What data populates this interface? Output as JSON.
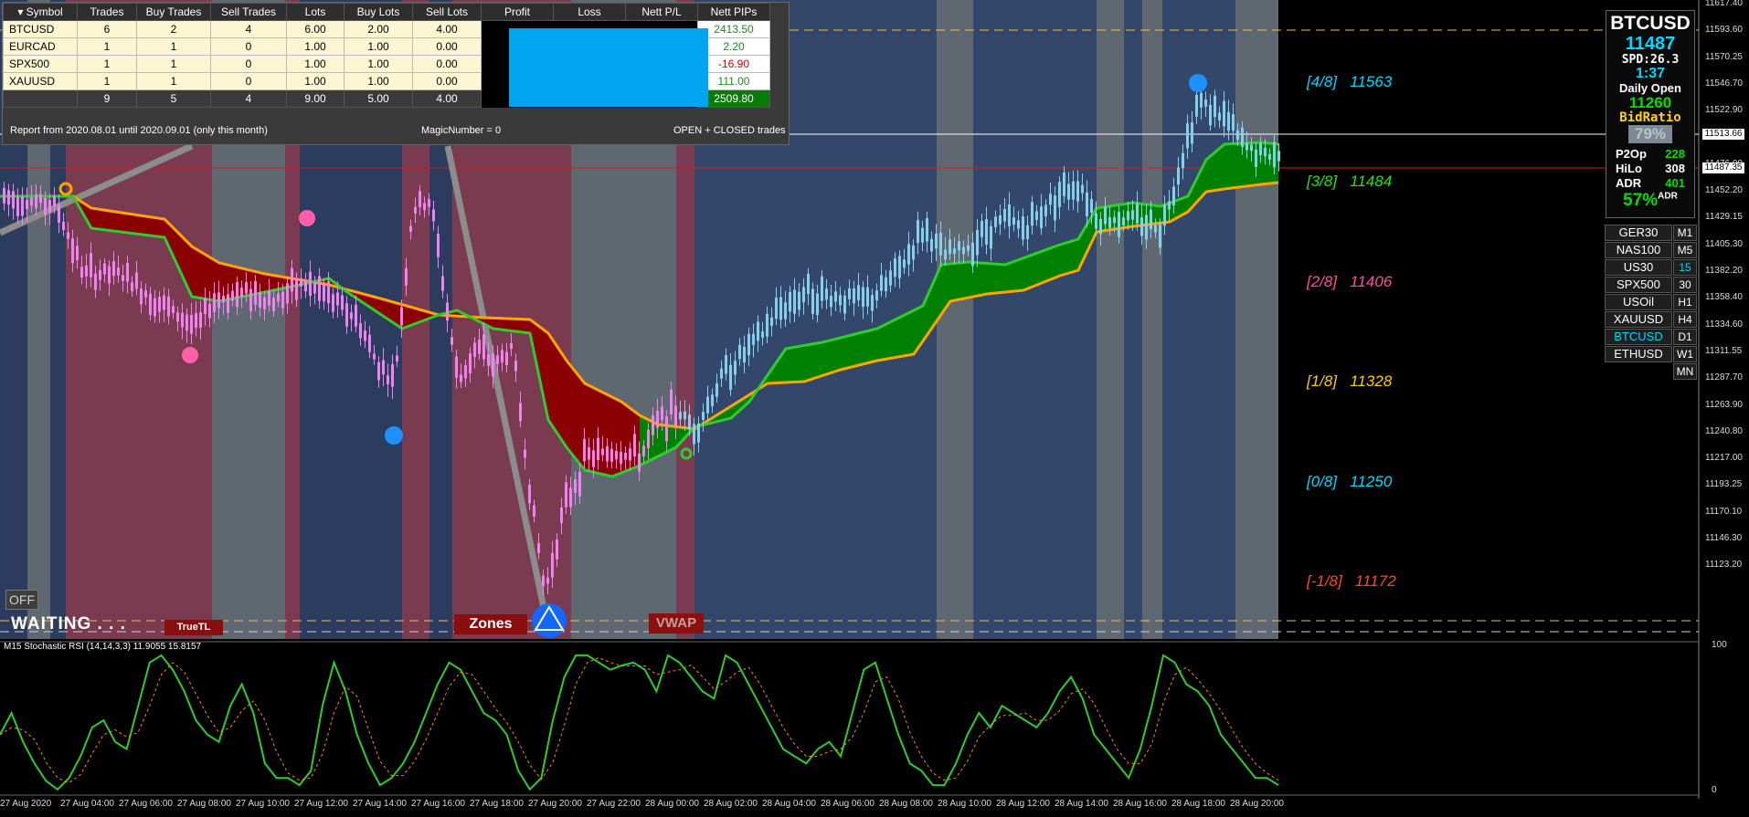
{
  "table": {
    "headers": [
      "Symbol",
      "Trades",
      "Buy Trades",
      "Sell Trades",
      "Lots",
      "Buy Lots",
      "Sell Lots",
      "Profit",
      "Loss",
      "Nett P/L",
      "Nett PIPs"
    ],
    "rows": [
      {
        "symbol": "BTCUSD",
        "trades": "6",
        "buy": "2",
        "sell": "4",
        "lots": "6.00",
        "buylots": "2.00",
        "selllots": "4.00",
        "pips": "2413.50"
      },
      {
        "symbol": "EURCAD",
        "trades": "1",
        "buy": "1",
        "sell": "0",
        "lots": "1.00",
        "buylots": "1.00",
        "selllots": "0.00",
        "pips": "2.20"
      },
      {
        "symbol": "SPX500",
        "trades": "1",
        "buy": "1",
        "sell": "0",
        "lots": "1.00",
        "buylots": "1.00",
        "selllots": "0.00",
        "pips": "-16.90"
      },
      {
        "symbol": "XAUUSD",
        "trades": "1",
        "buy": "1",
        "sell": "0",
        "lots": "1.00",
        "buylots": "1.00",
        "selllots": "0.00",
        "pips": "111.00"
      }
    ],
    "totals": {
      "trades": "9",
      "buy": "5",
      "sell": "4",
      "lots": "9.00",
      "buylots": "5.00",
      "selllots": "4.00",
      "pips": "2509.80"
    },
    "report": "Report from 2020.08.01 until 2020.09.01 (only this month)",
    "magic": "MagicNumber = 0",
    "mode": "OPEN + CLOSED trades"
  },
  "gann_levels": [
    {
      "label": "[4/8]",
      "value": "11563",
      "color": "#00d8ff"
    },
    {
      "label": "[3/8]",
      "value": "11484",
      "color": "#22e022"
    },
    {
      "label": "[2/8]",
      "value": "11406",
      "color": "#ff4fa0"
    },
    {
      "label": "[1/8]",
      "value": "11328",
      "color": "#ffcc00"
    },
    {
      "label": "[0/8]",
      "value": "11250",
      "color": "#00d8ff"
    },
    {
      "label": "[-1/8]",
      "value": "11172",
      "color": "#ff4a1a"
    }
  ],
  "info": {
    "symbol": "BTCUSD",
    "price": "11487",
    "spd": "SPD:26.3",
    "time": "1:37",
    "daily_open_label": "Daily Open",
    "daily_open": "11260",
    "bid_ratio_label": "BidRatio",
    "bid_ratio": "79%",
    "p2op_label": "P2Op",
    "p2op": "228",
    "hilo_label": "HiLo",
    "hilo": "308",
    "adr_label": "ADR",
    "adr": "401",
    "adr_pct": "57%",
    "adr_suffix": "ADR"
  },
  "symbols": [
    "GER30",
    "NAS100",
    "US30",
    "SPX500",
    "USOil",
    "XAUUSD",
    "BTCUSD",
    "ETHUSD"
  ],
  "active_symbol": "BTCUSD",
  "timeframes": [
    "M1",
    "M5",
    "15",
    "30",
    "H1",
    "H4",
    "D1",
    "W1",
    "MN"
  ],
  "active_timeframe": "15",
  "buttons": {
    "off": "OFF",
    "waiting": "WAITING . . .",
    "truetl": "TrueTL",
    "zones": "Zones",
    "vwap": "VWAP"
  },
  "price_axis": [
    "11617.40",
    "11593.60",
    "11570.25",
    "11546.70",
    "11522.90",
    "11499.80",
    "11476.00",
    "11452.20",
    "11429.15",
    "11405.30",
    "11382.20",
    "11358.40",
    "11334.60",
    "11311.55",
    "11287.70",
    "11263.90",
    "11240.80",
    "11217.00",
    "11193.25",
    "11170.10",
    "11146.30",
    "11123.20"
  ],
  "price_tag_white": "11513.66",
  "price_tag_red": "11487.35",
  "time_axis": [
    "27 Aug 2020",
    "27 Aug 04:00",
    "27 Aug 06:00",
    "27 Aug 08:00",
    "27 Aug 10:00",
    "27 Aug 12:00",
    "27 Aug 14:00",
    "27 Aug 16:00",
    "27 Aug 18:00",
    "27 Aug 20:00",
    "27 Aug 22:00",
    "28 Aug 00:00",
    "28 Aug 02:00",
    "28 Aug 04:00",
    "28 Aug 06:00",
    "28 Aug 08:00",
    "28 Aug 10:00",
    "28 Aug 12:00",
    "28 Aug 14:00",
    "28 Aug 16:00",
    "28 Aug 18:00",
    "28 Aug 20:00"
  ],
  "indicator": {
    "label": "M15 Stochastic RSI (14,14,3,3) 11.9055 15.8157",
    "scale_max": "100",
    "scale_min": "0"
  },
  "colors": {
    "bull": "#87ceeb",
    "bear": "#ee82ee",
    "cloud_bull": "#008000",
    "cloud_bear": "#8b0000",
    "line_green": "#2ecc2e",
    "line_orange": "#ffa500"
  }
}
